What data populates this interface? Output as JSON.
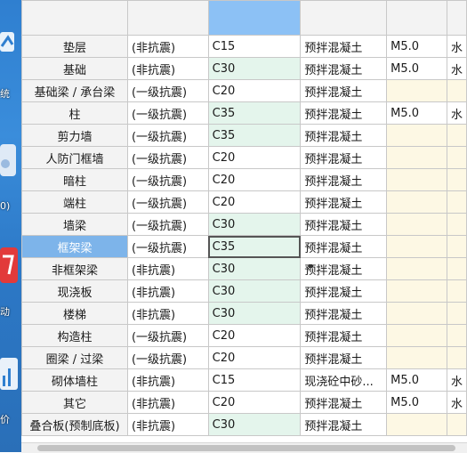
{
  "desktop": {
    "captions": [
      "统",
      "0)",
      "动",
      "价"
    ]
  },
  "rows": [
    {
      "name": "垫层",
      "grade": "(非抗震)",
      "strength": "C15",
      "concrete": "预拌混凝土",
      "mortar": "M5.0",
      "extra": "水"
    },
    {
      "name": "基础",
      "grade": "(非抗震)",
      "strength": "C30",
      "concrete": "预拌混凝土",
      "mortar": "M5.0",
      "extra": "水"
    },
    {
      "name": "基础梁 / 承台梁",
      "grade": "(一级抗震)",
      "strength": "C20",
      "concrete": "预拌混凝土",
      "mortar": "",
      "extra": ""
    },
    {
      "name": "柱",
      "grade": "(一级抗震)",
      "strength": "C35",
      "concrete": "预拌混凝土",
      "mortar": "M5.0",
      "extra": "水"
    },
    {
      "name": "剪力墙",
      "grade": "(一级抗震)",
      "strength": "C35",
      "concrete": "预拌混凝土",
      "mortar": "",
      "extra": ""
    },
    {
      "name": "人防门框墙",
      "grade": "(一级抗震)",
      "strength": "C20",
      "concrete": "预拌混凝土",
      "mortar": "",
      "extra": ""
    },
    {
      "name": "暗柱",
      "grade": "(一级抗震)",
      "strength": "C20",
      "concrete": "预拌混凝土",
      "mortar": "",
      "extra": ""
    },
    {
      "name": "端柱",
      "grade": "(一级抗震)",
      "strength": "C20",
      "concrete": "预拌混凝土",
      "mortar": "",
      "extra": ""
    },
    {
      "name": "墙梁",
      "grade": "(一级抗震)",
      "strength": "C30",
      "concrete": "预拌混凝土",
      "mortar": "",
      "extra": ""
    },
    {
      "name": "框架梁",
      "grade": "(一级抗震)",
      "strength": "C35",
      "concrete": "预拌混凝土",
      "mortar": "",
      "extra": ""
    },
    {
      "name": "非框架梁",
      "grade": "(非抗震)",
      "strength": "C30",
      "concrete": "预拌混凝土",
      "mortar": "",
      "extra": ""
    },
    {
      "name": "现浇板",
      "grade": "(非抗震)",
      "strength": "C30",
      "concrete": "预拌混凝土",
      "mortar": "",
      "extra": ""
    },
    {
      "name": "楼梯",
      "grade": "(非抗震)",
      "strength": "C30",
      "concrete": "预拌混凝土",
      "mortar": "",
      "extra": ""
    },
    {
      "name": "构造柱",
      "grade": "(一级抗震)",
      "strength": "C20",
      "concrete": "预拌混凝土",
      "mortar": "",
      "extra": ""
    },
    {
      "name": "圈梁 / 过梁",
      "grade": "(一级抗震)",
      "strength": "C20",
      "concrete": "预拌混凝土",
      "mortar": "",
      "extra": ""
    },
    {
      "name": "砌体墙柱",
      "grade": "(非抗震)",
      "strength": "C15",
      "concrete": "现浇砼中砂...",
      "mortar": "M5.0",
      "extra": "水"
    },
    {
      "name": "其它",
      "grade": "(非抗震)",
      "strength": "C20",
      "concrete": "预拌混凝土",
      "mortar": "M5.0",
      "extra": "水"
    },
    {
      "name": "叠合板(预制底板)",
      "grade": "(非抗震)",
      "strength": "C30",
      "concrete": "预拌混凝土",
      "mortar": "",
      "extra": ""
    }
  ],
  "selected_row": 9,
  "colors": {
    "header_highlight": "#8cc1f5",
    "selected_name": "#7db4ea",
    "modified_cell": "#e4f5ec",
    "empty_mortar": "#fdf8e4"
  }
}
